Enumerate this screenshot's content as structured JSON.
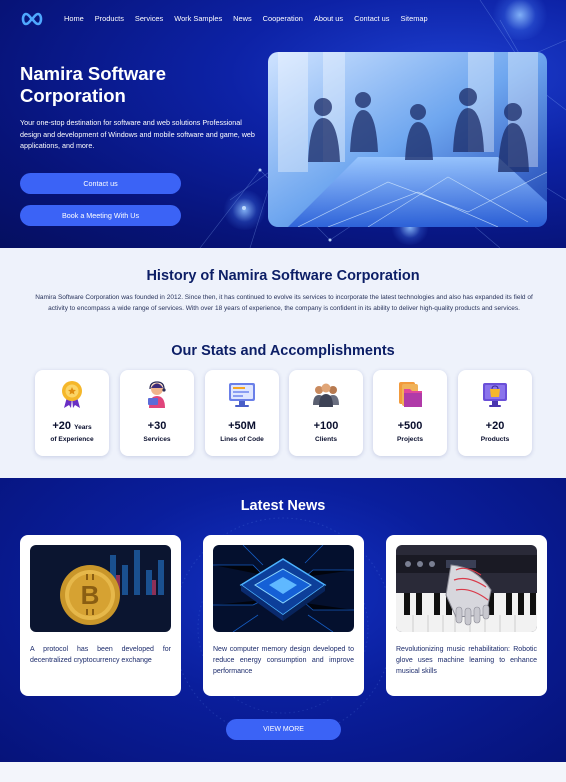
{
  "nav": {
    "logo_icon": "infinity-logo-icon",
    "items": [
      "Home",
      "Products",
      "Services",
      "Work Samples",
      "News",
      "Cooperation",
      "About us",
      "Contact us",
      "Sitemap"
    ]
  },
  "hero": {
    "title": "Namira Software Corporation",
    "description": "Your one-stop destination for software and web solutions Professional design and development of Windows and mobile software and game, web applications, and more.",
    "contact_button": "Contact us",
    "meeting_button": "Book a Meeting With Us"
  },
  "history": {
    "title": "History of Namira Software Corporation",
    "text": "Namira Software Corporation was founded in 2012. Since then, it has continued to evolve its services to incorporate the latest technologies and also has expanded its field of activity to encompass a wide range of services. With over 18 years of experience, the company is confident in its ability to deliver high-quality products and services."
  },
  "stats": {
    "title": "Our Stats and Accomplishments",
    "items": [
      {
        "value": "+20",
        "value_suffix": "Years",
        "label": "of Experience",
        "icon": "award-ribbon-icon"
      },
      {
        "value": "+30",
        "value_suffix": "",
        "label": "Services",
        "icon": "support-agent-icon"
      },
      {
        "value": "+50M",
        "value_suffix": "",
        "label": "Lines of Code",
        "icon": "monitor-code-icon"
      },
      {
        "value": "+100",
        "value_suffix": "",
        "label": "Clients",
        "icon": "people-group-icon"
      },
      {
        "value": "+500",
        "value_suffix": "",
        "label": "Projects",
        "icon": "folders-icon"
      },
      {
        "value": "+20",
        "value_suffix": "",
        "label": "Products",
        "icon": "shopping-screen-icon"
      }
    ]
  },
  "news": {
    "title": "Latest News",
    "items": [
      {
        "text": "A protocol has been developed for decentralized cryptocurrency exchange",
        "image": "bitcoin-coin-image"
      },
      {
        "text": "New computer memory design developed to reduce energy consumption and improve performance",
        "image": "computer-chip-image"
      },
      {
        "text": "Revolutionizing music rehabilitation: Robotic glove uses machine learning to enhance musical skills",
        "image": "robotic-glove-piano-image"
      }
    ],
    "view_more": "VIEW MORE"
  },
  "colors": {
    "hero_bg": "#0d22a6",
    "accent_button": "#3b63f6",
    "heading_navy": "#0c1e66",
    "section_light": "#eef2fb"
  }
}
